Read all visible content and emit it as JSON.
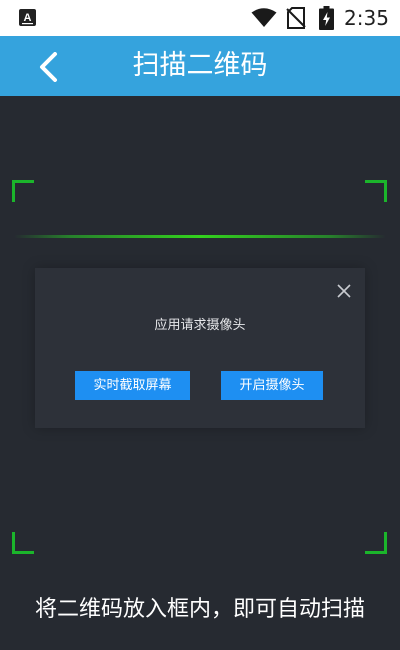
{
  "status_bar": {
    "time": "2:35",
    "icons": [
      "app-notification-icon",
      "wifi-icon",
      "no-sim-icon",
      "battery-charging-icon"
    ]
  },
  "header": {
    "title": "扫描二维码",
    "back_icon": "chevron-left-icon"
  },
  "scanner": {
    "frame_color": "#1bb52b",
    "line_color": "#33d21e"
  },
  "dialog": {
    "message": "应用请求摄像头",
    "close_icon": "close-icon",
    "buttons": {
      "screen_capture": "实时截取屏幕",
      "open_camera": "开启摄像头"
    },
    "button_color": "#1e8ff2"
  },
  "hint": "将二维码放入框内，即可自动扫描",
  "colors": {
    "header": "#35a3dd",
    "background": "#262a31",
    "dialog": "#2d3139"
  }
}
